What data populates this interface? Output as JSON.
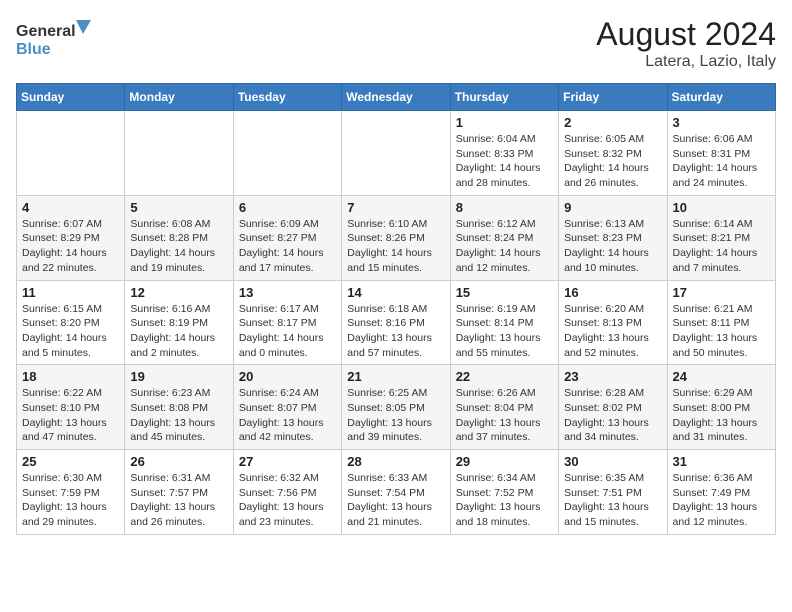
{
  "header": {
    "logo_line1": "General",
    "logo_line2": "Blue",
    "title": "August 2024",
    "subtitle": "Latera, Lazio, Italy"
  },
  "weekdays": [
    "Sunday",
    "Monday",
    "Tuesday",
    "Wednesday",
    "Thursday",
    "Friday",
    "Saturday"
  ],
  "weeks": [
    [
      {
        "day": "",
        "info": ""
      },
      {
        "day": "",
        "info": ""
      },
      {
        "day": "",
        "info": ""
      },
      {
        "day": "",
        "info": ""
      },
      {
        "day": "1",
        "info": "Sunrise: 6:04 AM\nSunset: 8:33 PM\nDaylight: 14 hours\nand 28 minutes."
      },
      {
        "day": "2",
        "info": "Sunrise: 6:05 AM\nSunset: 8:32 PM\nDaylight: 14 hours\nand 26 minutes."
      },
      {
        "day": "3",
        "info": "Sunrise: 6:06 AM\nSunset: 8:31 PM\nDaylight: 14 hours\nand 24 minutes."
      }
    ],
    [
      {
        "day": "4",
        "info": "Sunrise: 6:07 AM\nSunset: 8:29 PM\nDaylight: 14 hours\nand 22 minutes."
      },
      {
        "day": "5",
        "info": "Sunrise: 6:08 AM\nSunset: 8:28 PM\nDaylight: 14 hours\nand 19 minutes."
      },
      {
        "day": "6",
        "info": "Sunrise: 6:09 AM\nSunset: 8:27 PM\nDaylight: 14 hours\nand 17 minutes."
      },
      {
        "day": "7",
        "info": "Sunrise: 6:10 AM\nSunset: 8:26 PM\nDaylight: 14 hours\nand 15 minutes."
      },
      {
        "day": "8",
        "info": "Sunrise: 6:12 AM\nSunset: 8:24 PM\nDaylight: 14 hours\nand 12 minutes."
      },
      {
        "day": "9",
        "info": "Sunrise: 6:13 AM\nSunset: 8:23 PM\nDaylight: 14 hours\nand 10 minutes."
      },
      {
        "day": "10",
        "info": "Sunrise: 6:14 AM\nSunset: 8:21 PM\nDaylight: 14 hours\nand 7 minutes."
      }
    ],
    [
      {
        "day": "11",
        "info": "Sunrise: 6:15 AM\nSunset: 8:20 PM\nDaylight: 14 hours\nand 5 minutes."
      },
      {
        "day": "12",
        "info": "Sunrise: 6:16 AM\nSunset: 8:19 PM\nDaylight: 14 hours\nand 2 minutes."
      },
      {
        "day": "13",
        "info": "Sunrise: 6:17 AM\nSunset: 8:17 PM\nDaylight: 14 hours\nand 0 minutes."
      },
      {
        "day": "14",
        "info": "Sunrise: 6:18 AM\nSunset: 8:16 PM\nDaylight: 13 hours\nand 57 minutes."
      },
      {
        "day": "15",
        "info": "Sunrise: 6:19 AM\nSunset: 8:14 PM\nDaylight: 13 hours\nand 55 minutes."
      },
      {
        "day": "16",
        "info": "Sunrise: 6:20 AM\nSunset: 8:13 PM\nDaylight: 13 hours\nand 52 minutes."
      },
      {
        "day": "17",
        "info": "Sunrise: 6:21 AM\nSunset: 8:11 PM\nDaylight: 13 hours\nand 50 minutes."
      }
    ],
    [
      {
        "day": "18",
        "info": "Sunrise: 6:22 AM\nSunset: 8:10 PM\nDaylight: 13 hours\nand 47 minutes."
      },
      {
        "day": "19",
        "info": "Sunrise: 6:23 AM\nSunset: 8:08 PM\nDaylight: 13 hours\nand 45 minutes."
      },
      {
        "day": "20",
        "info": "Sunrise: 6:24 AM\nSunset: 8:07 PM\nDaylight: 13 hours\nand 42 minutes."
      },
      {
        "day": "21",
        "info": "Sunrise: 6:25 AM\nSunset: 8:05 PM\nDaylight: 13 hours\nand 39 minutes."
      },
      {
        "day": "22",
        "info": "Sunrise: 6:26 AM\nSunset: 8:04 PM\nDaylight: 13 hours\nand 37 minutes."
      },
      {
        "day": "23",
        "info": "Sunrise: 6:28 AM\nSunset: 8:02 PM\nDaylight: 13 hours\nand 34 minutes."
      },
      {
        "day": "24",
        "info": "Sunrise: 6:29 AM\nSunset: 8:00 PM\nDaylight: 13 hours\nand 31 minutes."
      }
    ],
    [
      {
        "day": "25",
        "info": "Sunrise: 6:30 AM\nSunset: 7:59 PM\nDaylight: 13 hours\nand 29 minutes."
      },
      {
        "day": "26",
        "info": "Sunrise: 6:31 AM\nSunset: 7:57 PM\nDaylight: 13 hours\nand 26 minutes."
      },
      {
        "day": "27",
        "info": "Sunrise: 6:32 AM\nSunset: 7:56 PM\nDaylight: 13 hours\nand 23 minutes."
      },
      {
        "day": "28",
        "info": "Sunrise: 6:33 AM\nSunset: 7:54 PM\nDaylight: 13 hours\nand 21 minutes."
      },
      {
        "day": "29",
        "info": "Sunrise: 6:34 AM\nSunset: 7:52 PM\nDaylight: 13 hours\nand 18 minutes."
      },
      {
        "day": "30",
        "info": "Sunrise: 6:35 AM\nSunset: 7:51 PM\nDaylight: 13 hours\nand 15 minutes."
      },
      {
        "day": "31",
        "info": "Sunrise: 6:36 AM\nSunset: 7:49 PM\nDaylight: 13 hours\nand 12 minutes."
      }
    ]
  ]
}
